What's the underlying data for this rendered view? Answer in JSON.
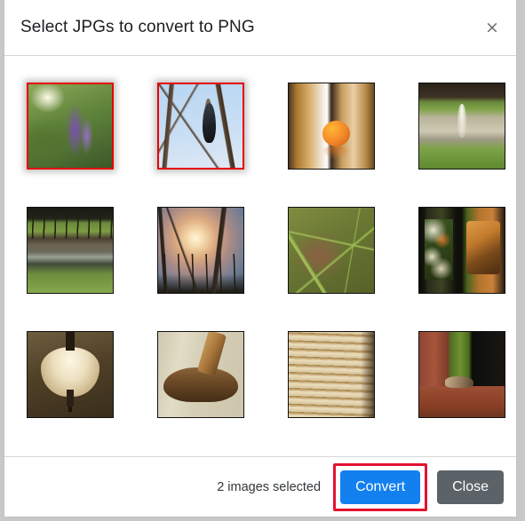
{
  "dialog": {
    "title": "Select JPGs to convert to PNG",
    "close_icon_glyph": "×"
  },
  "footer": {
    "selected_count_text": "2 images selected",
    "convert_label": "Convert",
    "close_label": "Close"
  },
  "colors": {
    "convert_button": "#1380ef",
    "close_button": "#5b6369",
    "selection_border": "#e60000",
    "annotation_highlight": "#e3122f",
    "dialog_background": "#ffffff",
    "page_background": "#c8c8c8",
    "separator": "#d6d6d6",
    "title_text": "#1c1e21"
  },
  "thumbnails": [
    {
      "index": 1,
      "description": "purple flower spike on blurred green foliage",
      "selected": true,
      "art": "a1"
    },
    {
      "index": 2,
      "description": "cormorant bird perched in bare tree against blue sky",
      "selected": true,
      "art": "a2"
    },
    {
      "index": 3,
      "description": "orange fruit on glossy indoor surface",
      "selected": false,
      "art": "a3"
    },
    {
      "index": 4,
      "description": "water fountain in pond with green grass banks",
      "selected": false,
      "art": "a4"
    },
    {
      "index": 5,
      "description": "bare trees above muddy pond and grass",
      "selected": false,
      "art": "a5"
    },
    {
      "index": 6,
      "description": "sunset glowing through trees and reeds",
      "selected": false,
      "art": "a6"
    },
    {
      "index": 7,
      "description": "close-up of green grass blades over brown ground",
      "selected": false,
      "art": "a7"
    },
    {
      "index": 8,
      "description": "bento tray with grilled salmon and vegetables",
      "selected": false,
      "art": "a8"
    },
    {
      "index": 9,
      "description": "glowing pendant lamp shade on ceiling",
      "selected": false,
      "art": "a9"
    },
    {
      "index": 10,
      "description": "wooden stool seat and chair back detail",
      "selected": false,
      "art": "a10"
    },
    {
      "index": 11,
      "description": "stacked book page edges close-up",
      "selected": false,
      "art": "a11"
    },
    {
      "index": 12,
      "description": "bird on red brick ledge beside open doorway",
      "selected": false,
      "art": "a12"
    }
  ]
}
